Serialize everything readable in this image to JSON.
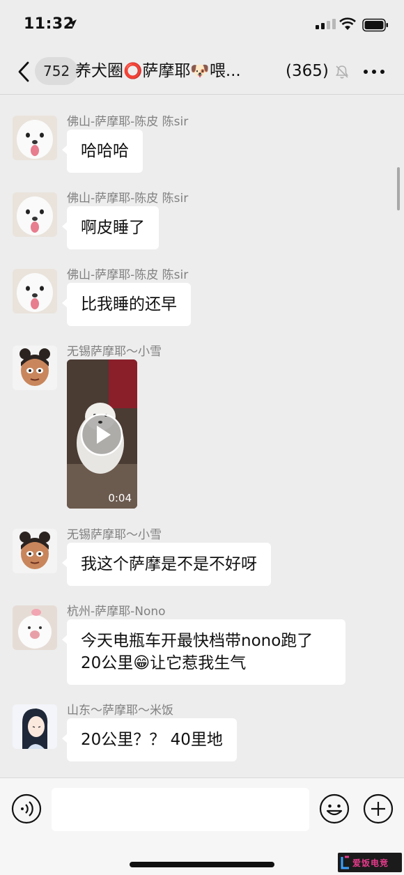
{
  "status_bar": {
    "time": "11:32"
  },
  "nav": {
    "unread_count": "752",
    "title_parts": [
      "养犬圈",
      "⭕",
      "萨摩耶",
      "🐶",
      "喂..."
    ],
    "member_count": "(365)"
  },
  "messages": [
    {
      "sender": "佛山-萨摩耶-陈皮 陈sir",
      "text": "哈哈哈",
      "avatar": "samoyed-avatar"
    },
    {
      "sender": "佛山-萨摩耶-陈皮 陈sir",
      "text": "啊皮睡了",
      "avatar": "samoyed-avatar"
    },
    {
      "sender": "佛山-萨摩耶-陈皮 陈sir",
      "text": "比我睡的还早",
      "avatar": "samoyed-avatar"
    },
    {
      "sender": "无锡萨摩耶～小雪",
      "video_duration": "0:04",
      "avatar": "cartoon-girl-avatar"
    },
    {
      "sender": "无锡萨摩耶～小雪",
      "text": "我这个萨摩是不是不好呀",
      "avatar": "cartoon-girl-avatar"
    },
    {
      "sender": "杭州-萨摩耶-Nono",
      "text_before": "今天电瓶车开最快档带nono跑了20公里",
      "emoji": "😁",
      "text_after": "让它惹我生气",
      "avatar": "white-dog-avatar"
    },
    {
      "sender": "山东～萨摩耶～米饭",
      "text": "20公里？？ 40里地",
      "avatar": "girl-illustration-avatar"
    }
  ],
  "input_bar": {
    "placeholder": ""
  },
  "watermark": {
    "text": "爱饭电竞"
  },
  "colors": {
    "background": "#ededed",
    "bubble": "#ffffff",
    "sender_text": "#808080"
  }
}
